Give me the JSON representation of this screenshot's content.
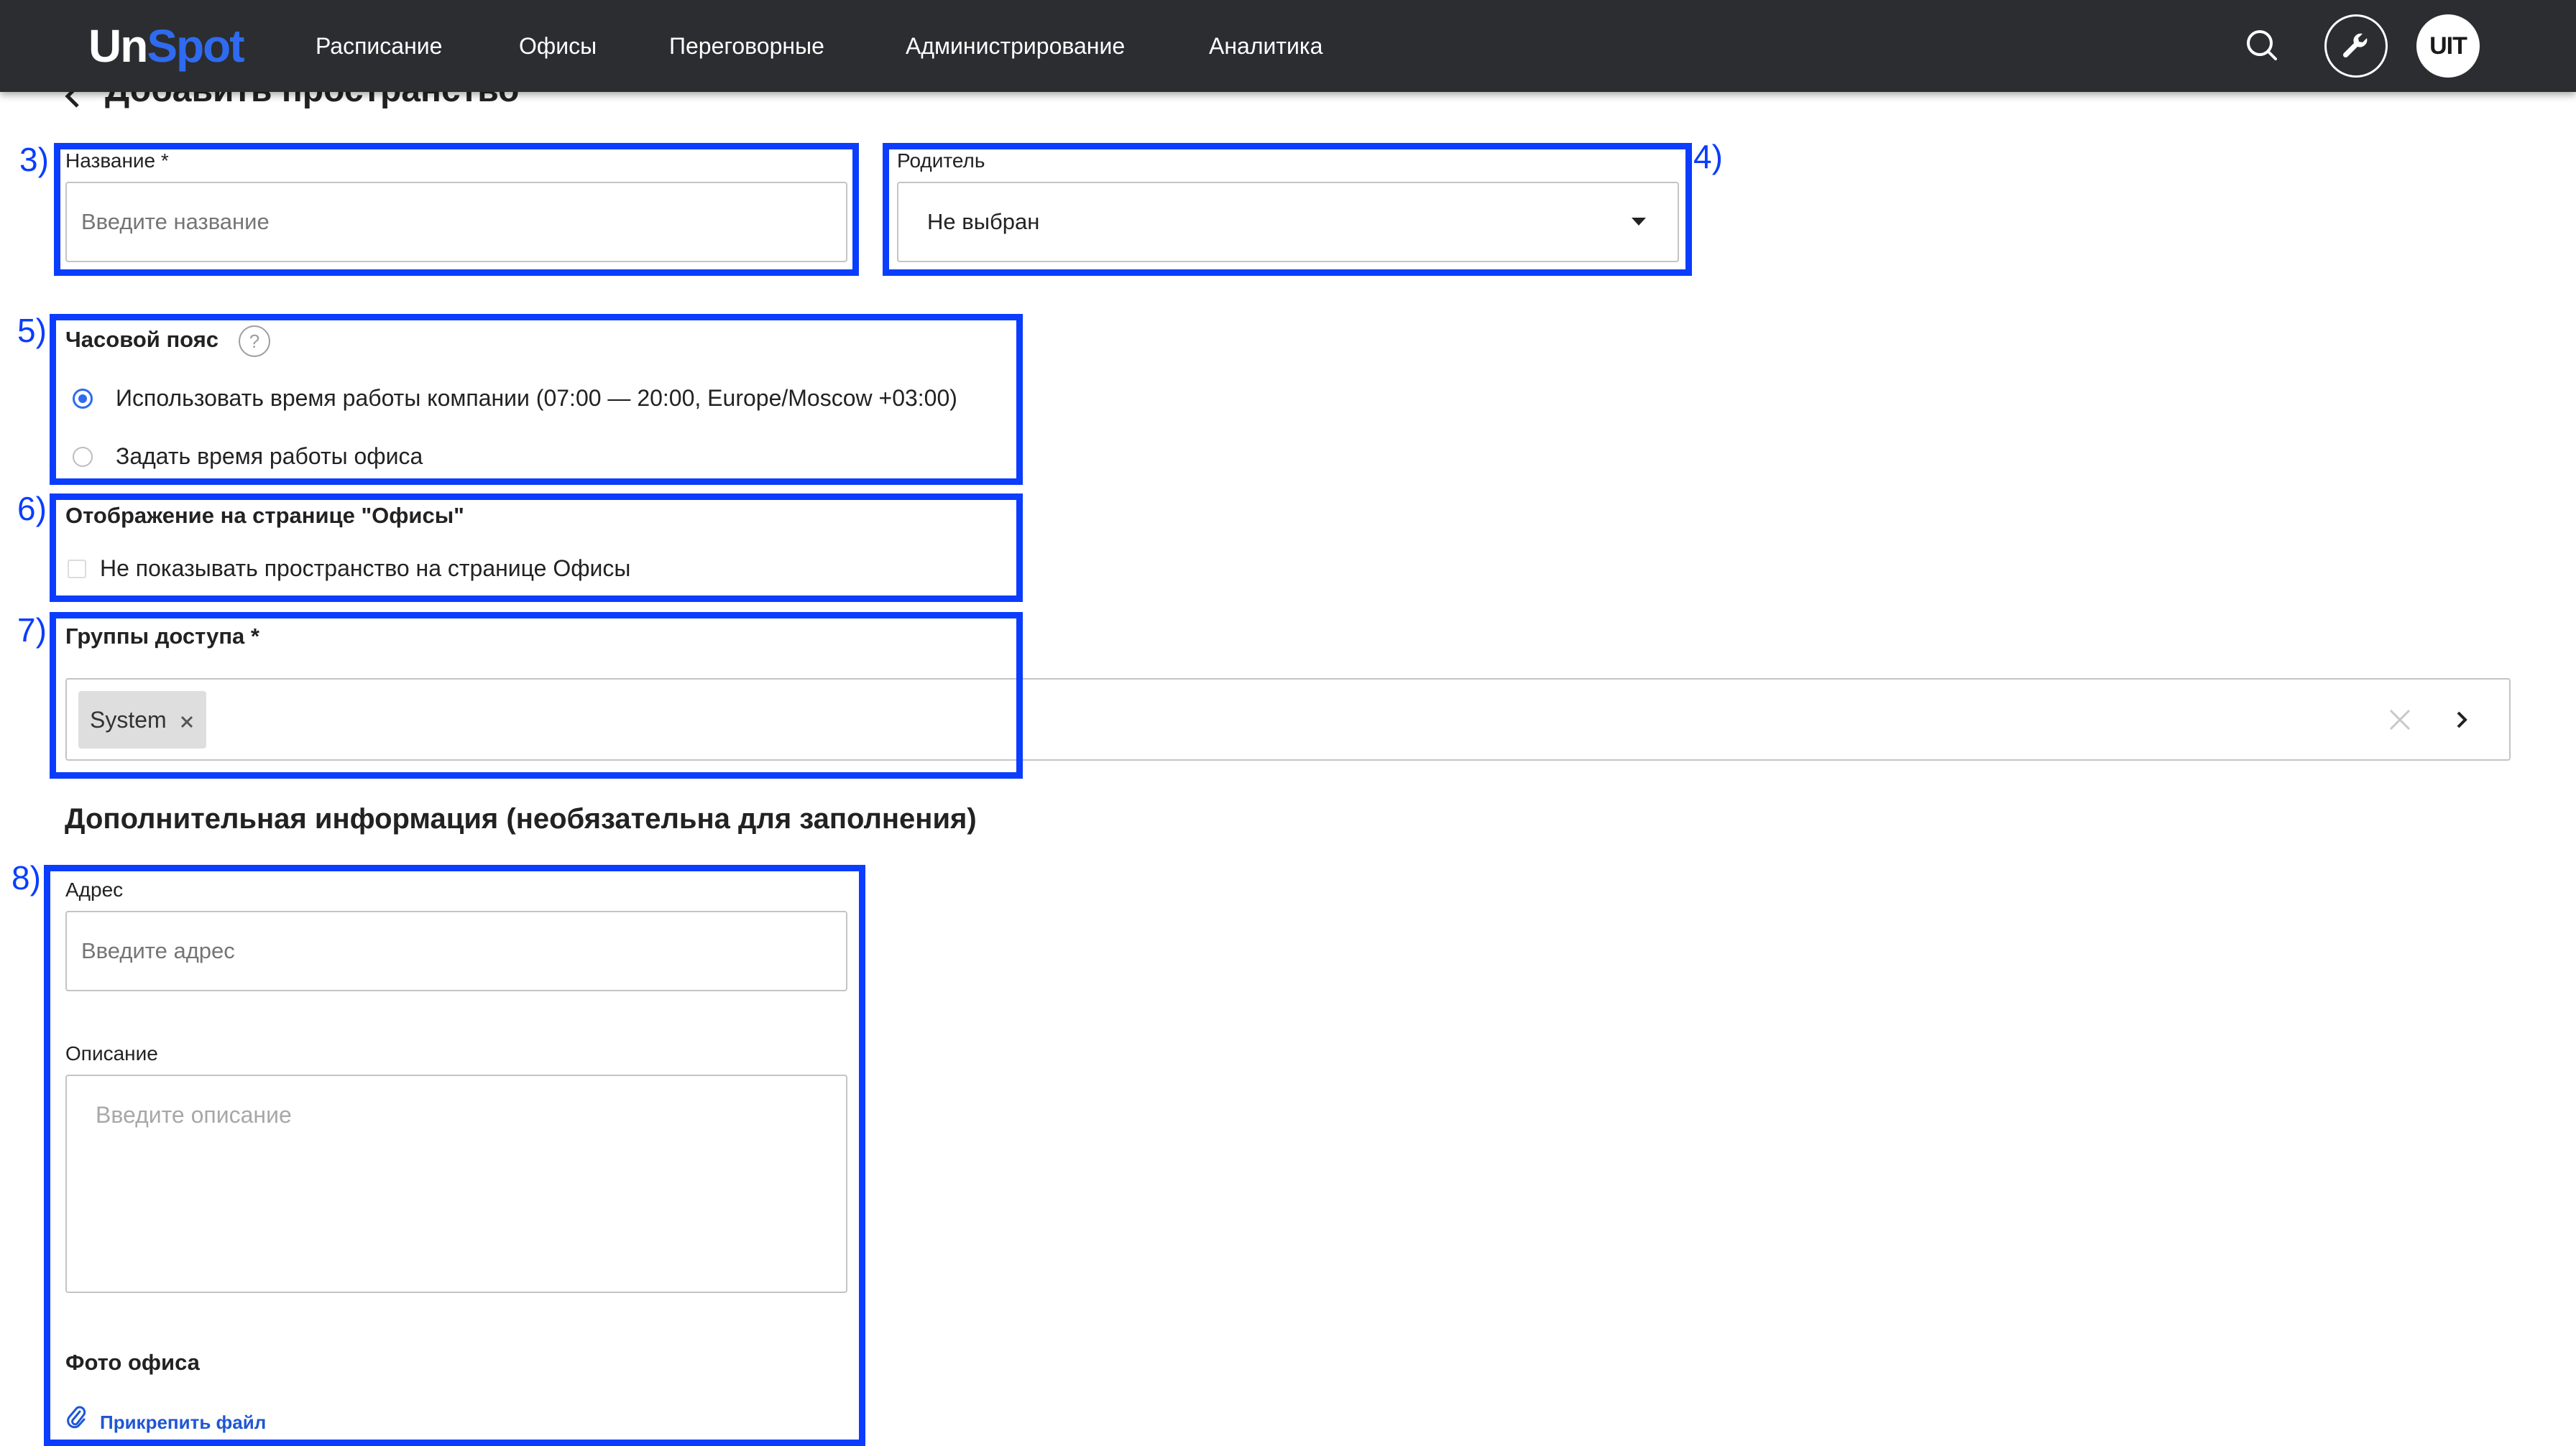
{
  "app": {
    "logo_part1": "Un",
    "logo_part2": "Spot",
    "accent_color": "#2f6bf0",
    "annotation_color": "#0a3dff"
  },
  "nav": {
    "items": [
      {
        "label": "Расписание"
      },
      {
        "label": "Офисы"
      },
      {
        "label": "Переговорные"
      },
      {
        "label": "Администрирование"
      },
      {
        "label": "Аналитика"
      }
    ],
    "avatar_text": "UIT",
    "icons": [
      "search-icon",
      "wrench-icon"
    ]
  },
  "page": {
    "title": "Добавить пространство"
  },
  "annotations": [
    "3)",
    "4)",
    "5)",
    "6)",
    "7)",
    "8)"
  ],
  "form": {
    "name": {
      "label": "Название *",
      "placeholder": "Введите название",
      "value": ""
    },
    "parent": {
      "label": "Родитель",
      "value": "Не выбран"
    },
    "timezone": {
      "label": "Часовой пояс",
      "help": "?",
      "options": [
        {
          "label": "Использовать время работы компании (07:00 — 20:00, Europe/Moscow +03:00)",
          "checked": true
        },
        {
          "label": "Задать время работы офиса",
          "checked": false
        }
      ]
    },
    "offices_display": {
      "label": "Отображение на странице \"Офисы\"",
      "checkbox_label": "Не показывать пространство на странице Офисы",
      "checked": false
    },
    "access_groups": {
      "label": "Группы доступа *",
      "chips": [
        "System"
      ]
    },
    "additional": {
      "title": "Дополнительная информация (необязательна для заполнения)",
      "address": {
        "label": "Адрес",
        "placeholder": "Введите адрес",
        "value": ""
      },
      "description": {
        "label": "Описание",
        "placeholder": "Введите описание",
        "value": ""
      },
      "photo": {
        "label": "Фото офиса",
        "attach_label": "Прикрепить файл"
      }
    }
  }
}
